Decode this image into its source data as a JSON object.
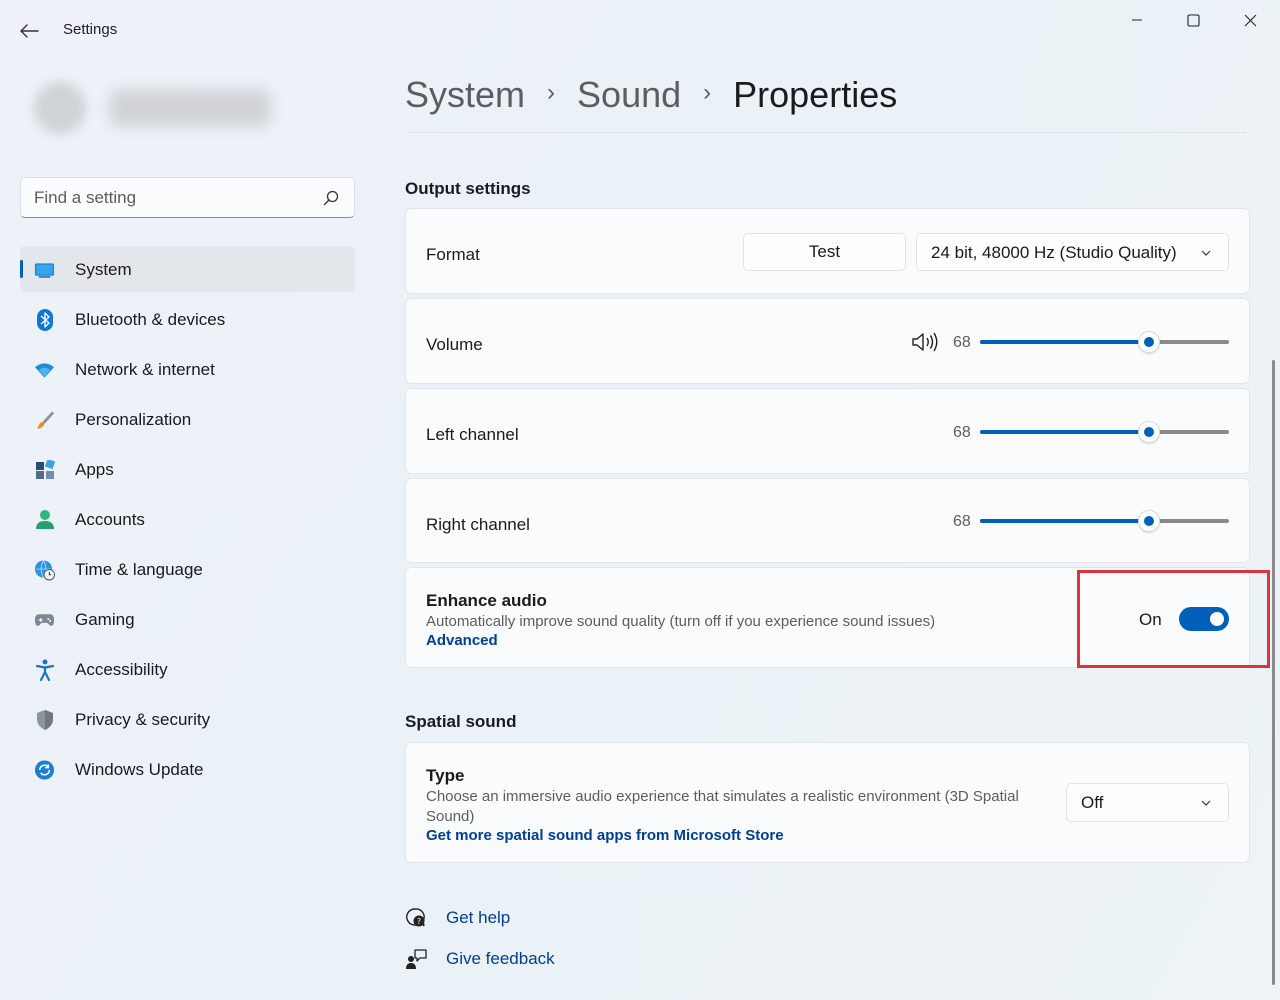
{
  "window": {
    "title": "Settings",
    "controls": [
      "minimize",
      "maximize",
      "close"
    ]
  },
  "search": {
    "placeholder": "Find a setting"
  },
  "sidebar": {
    "items": [
      {
        "label": "System",
        "icon": "system-icon",
        "active": true
      },
      {
        "label": "Bluetooth & devices",
        "icon": "bluetooth-icon"
      },
      {
        "label": "Network & internet",
        "icon": "wifi-icon"
      },
      {
        "label": "Personalization",
        "icon": "brush-icon"
      },
      {
        "label": "Apps",
        "icon": "apps-icon"
      },
      {
        "label": "Accounts",
        "icon": "person-icon"
      },
      {
        "label": "Time & language",
        "icon": "globe-clock-icon"
      },
      {
        "label": "Gaming",
        "icon": "gamepad-icon"
      },
      {
        "label": "Accessibility",
        "icon": "accessibility-icon"
      },
      {
        "label": "Privacy & security",
        "icon": "shield-icon"
      },
      {
        "label": "Windows Update",
        "icon": "update-icon"
      }
    ]
  },
  "breadcrumb": {
    "items": [
      "System",
      "Sound",
      "Properties"
    ],
    "separator": "›"
  },
  "output": {
    "section_title": "Output settings",
    "format": {
      "label": "Format",
      "test_button": "Test",
      "selected": "24 bit, 48000 Hz (Studio Quality)"
    },
    "volume": {
      "label": "Volume",
      "value": "68",
      "fraction": 0.68
    },
    "left_channel": {
      "label": "Left channel",
      "value": "68",
      "fraction": 0.68
    },
    "right_channel": {
      "label": "Right channel",
      "value": "68",
      "fraction": 0.68
    },
    "enhance": {
      "title": "Enhance audio",
      "description": "Automatically improve sound quality (turn off if you experience sound issues)",
      "link": "Advanced",
      "state_label": "On",
      "on": true
    }
  },
  "spatial": {
    "section_title": "Spatial sound",
    "type": {
      "title": "Type",
      "description": "Choose an immersive audio experience that simulates a realistic environment (3D Spatial Sound)",
      "link": "Get more spatial sound apps from Microsoft Store",
      "selected": "Off"
    }
  },
  "help": {
    "get_help": "Get help",
    "give_feedback": "Give feedback"
  },
  "colors": {
    "accent": "#005fb8",
    "highlight_box": "#d9353f",
    "link": "#003e92"
  }
}
